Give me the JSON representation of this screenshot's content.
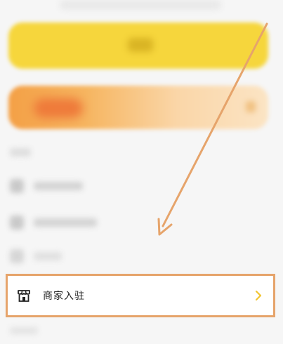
{
  "colors": {
    "accent_highlight": "#e6a46b",
    "banner_yellow": "#f6d63c",
    "banner_orange": "#f4a046",
    "chevron": "#f2c531",
    "background": "#f6f6f6"
  },
  "menu": {
    "merchant_entry": {
      "label": "商家入驻",
      "icon": "storefront-icon",
      "chevron": "chevron-right-icon"
    }
  },
  "annotation": {
    "icon": "pointer-arrow"
  }
}
